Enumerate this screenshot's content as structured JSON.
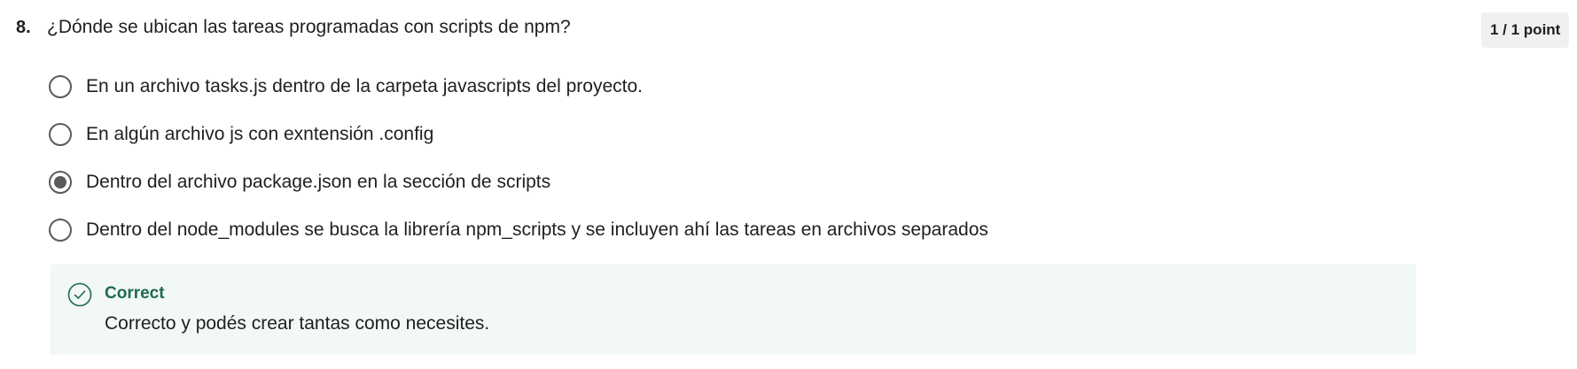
{
  "question": {
    "number": "8.",
    "text": "¿Dónde se ubican las tareas programadas con scripts de npm?",
    "score": "1 / 1 point"
  },
  "options": [
    {
      "label": "En un archivo tasks.js dentro de la carpeta javascripts del proyecto.",
      "selected": false
    },
    {
      "label": "En algún archivo js con exntensión .config",
      "selected": false
    },
    {
      "label": "Dentro del archivo package.json en la sección de scripts",
      "selected": true
    },
    {
      "label": "Dentro del node_modules se busca la librería npm_scripts y se incluyen ahí las tareas en archivos separados",
      "selected": false
    }
  ],
  "feedback": {
    "icon": "check-circle-icon",
    "title": "Correct",
    "text": "Correcto y podés crear tantas como necesites."
  },
  "colors": {
    "correct_green": "#1e6b4e",
    "feedback_bg": "#f2f8f5",
    "radio_gray": "#5b5b5b"
  }
}
